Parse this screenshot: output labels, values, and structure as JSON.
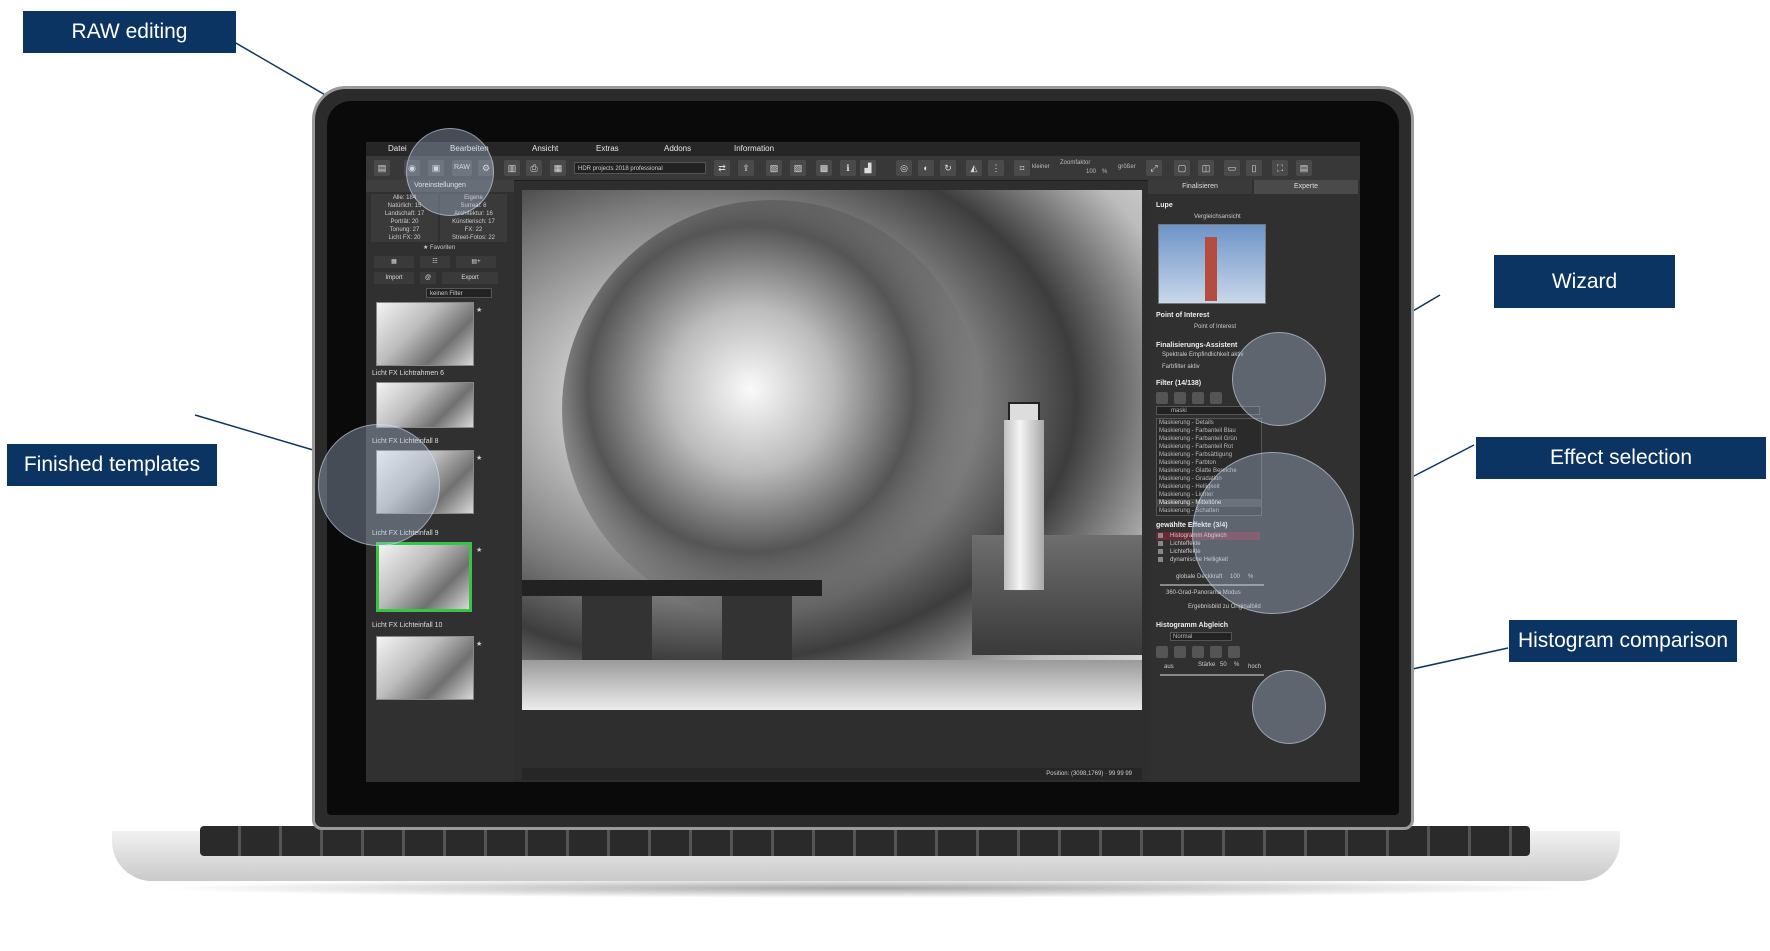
{
  "callouts": {
    "raw": "RAW editing",
    "templates": "Finished templates",
    "wizard": "Wizard",
    "effects": "Effect selection",
    "histogram": "Histogram comparison"
  },
  "menu": [
    "Datei",
    "Bearbeiten",
    "Ansicht",
    "Extras",
    "Addons",
    "Information"
  ],
  "toolbar": {
    "raw_label": "RAW",
    "preset": "HDR projects 2018 professional",
    "zoom_label": "Zoomfaktor",
    "zoom_value": "100",
    "zoom_unit": "%",
    "smaller": "kleiner",
    "larger": "größer"
  },
  "left_panel": {
    "title": "Voreinstellungen",
    "stats": [
      [
        "Alle: 184",
        "Eigene"
      ],
      [
        "Natürlich: 15",
        "Surreal: 8"
      ],
      [
        "Landschaft: 17",
        "Architektur: 16"
      ],
      [
        "Porträt: 20",
        "Künstlerisch: 17"
      ],
      [
        "Tonung: 27",
        "FX: 22"
      ],
      [
        "Licht FX: 20",
        "Street-Fotos: 22"
      ]
    ],
    "favorites": "★ Favoriten",
    "import": "Import",
    "export": "Export",
    "filter": "keinen Filter",
    "thumbs": [
      "Licht FX Lichtrahmen 6",
      "Licht FX Lichteinfall 8",
      "Licht FX Lichteinfall 9",
      "Licht FX Lichteinfall 10"
    ]
  },
  "status": "Position: (3098,1769) · 99 99 99",
  "right_panel": {
    "tab_finalize": "Finalisieren",
    "tab_expert": "Experte",
    "loupe": "Lupe",
    "compare": "Vergleichsansicht",
    "poi": "Point of Interest",
    "poi_btn": "Point of Interest",
    "wizard_title": "Finalisierungs-Assistent",
    "wizard_items": [
      "Spektrale Empfindlichkeit aktiv",
      "Farbfilter aktiv"
    ],
    "filter_title": "Filter (14/138)",
    "search": "maski",
    "filters": [
      "Maskierung - Details",
      "Maskierung - Farbanteil Blau",
      "Maskierung - Farbanteil Grün",
      "Maskierung - Farbanteil Rot",
      "Maskierung - Farbsättigung",
      "Maskierung - Farbton",
      "Maskierung - Glatte Bereiche",
      "Maskierung - Gradation",
      "Maskierung - Helligkeit",
      "Maskierung - Lichter",
      "Maskierung - Mitteltöne",
      "Maskierung - Schatten"
    ],
    "effects_title": "gewählte Effekte (3/4)",
    "effects": [
      "Histogramm Abgleich",
      "Lichteffekte",
      "Lichteffekte",
      "dynamische Helligkeit"
    ],
    "opacity_label": "globale Deckkraft",
    "opacity_value": "100",
    "opacity_unit": "%",
    "panorama": "360-Grad-Panorama Modus",
    "original": "Ergebnisbild zu Originalbild",
    "hist_title": "Histogramm Abgleich",
    "hist_mode": "Normal",
    "strength_label": "Stärke",
    "strength_value": "50",
    "strength_unit": "%",
    "low": "aus",
    "high": "hoch"
  }
}
